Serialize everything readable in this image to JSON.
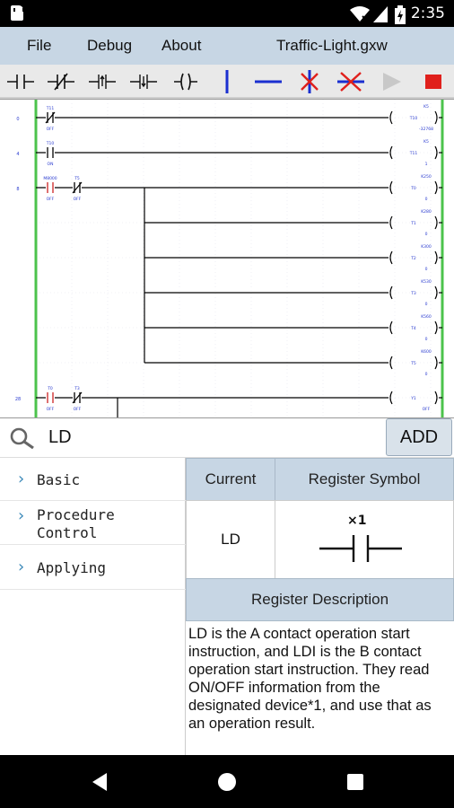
{
  "status_bar": {
    "time": "2:35"
  },
  "menu": {
    "items": [
      "File",
      "Debug",
      "About"
    ],
    "document_title": "Traffic-Light.gxw"
  },
  "toolbar": {
    "tools": [
      "no-contact-icon",
      "nc-contact-icon",
      "rising-edge-contact-icon",
      "falling-edge-contact-icon",
      "coil-icon",
      "vertical-line-icon",
      "horizontal-line-icon",
      "delete-vertical-line-icon",
      "delete-horizontal-line-icon",
      "run-icon",
      "stop-icon"
    ],
    "colors": {
      "line": "#1a2fd0",
      "delete": "#e0201c",
      "stop": "#e0201c",
      "run_disabled": "#c8c8c8"
    }
  },
  "ladder": {
    "rungs": [
      {
        "step": "0",
        "contacts": [
          {
            "label": "T11",
            "state": "OFF",
            "type": "nc"
          }
        ],
        "coil": {
          "device": "T10",
          "setting": "K5",
          "value": "-32768"
        }
      },
      {
        "step": "4",
        "contacts": [
          {
            "label": "T10",
            "state": "ON",
            "type": "no"
          }
        ],
        "coil": {
          "device": "T11",
          "setting": "K5",
          "value": "1"
        }
      },
      {
        "step": "8",
        "contacts": [
          {
            "label": "M8000",
            "state": "OFF",
            "type": "no-red"
          },
          {
            "label": "T5",
            "state": "OFF",
            "type": "nc"
          }
        ],
        "coil": {
          "device": "T0",
          "setting": "K250",
          "value": "0"
        }
      },
      {
        "step": "",
        "contacts": [],
        "coil": {
          "device": "T1",
          "setting": "K280",
          "value": "0"
        }
      },
      {
        "step": "",
        "contacts": [],
        "coil": {
          "device": "T2",
          "setting": "K300",
          "value": "0"
        }
      },
      {
        "step": "",
        "contacts": [],
        "coil": {
          "device": "T3",
          "setting": "K530",
          "value": "0"
        }
      },
      {
        "step": "",
        "contacts": [],
        "coil": {
          "device": "T4",
          "setting": "K560",
          "value": "0"
        }
      },
      {
        "step": "",
        "contacts": [],
        "coil": {
          "device": "T5",
          "setting": "K600",
          "value": "0"
        }
      },
      {
        "step": "28",
        "contacts": [
          {
            "label": "T0",
            "state": "OFF",
            "type": "no-red"
          },
          {
            "label": "T3",
            "state": "OFF",
            "type": "nc"
          }
        ],
        "coil": {
          "device": "Y1",
          "setting": "",
          "value": "OFF"
        }
      }
    ],
    "colors": {
      "rail": "#4cc34c",
      "label": "#2a3bd0",
      "wire": "#000000",
      "active": "#cc2222"
    }
  },
  "search": {
    "query": "LD",
    "add_label": "ADD"
  },
  "categories": [
    {
      "label_lines": [
        "Basic"
      ]
    },
    {
      "label_lines": [
        "Procedure",
        "Control"
      ]
    },
    {
      "label_lines": [
        "Applying"
      ]
    }
  ],
  "detail": {
    "current_header": "Current",
    "symbol_header": "Register Symbol",
    "current_value": "LD",
    "symbol_label": "×1",
    "description_header": "Register Description",
    "description": "LD is the A contact operation start instruction, and LDI is the B contact operation start instruction. They read ON/OFF information from the designated device*1, and use that as an operation result."
  }
}
